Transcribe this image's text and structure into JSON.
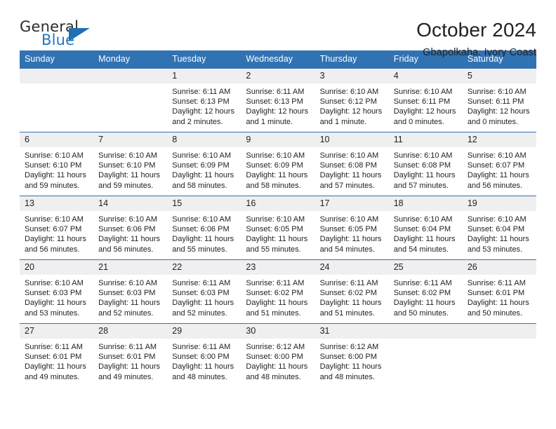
{
  "brand": {
    "name_top": "General",
    "name_bottom": "Blue",
    "color_blue": "#1f77c4",
    "color_dark": "#2b2b2b",
    "triangle_icon": "triangle-icon"
  },
  "header": {
    "title": "October 2024",
    "subtitle": "Gbapolkaha, Ivory Coast"
  },
  "theme": {
    "header_bg": "#3172b3",
    "header_text": "#ffffff",
    "daynum_bg": "#efefef",
    "cell_bg": "#ffffff",
    "text": "#222222"
  },
  "weekdays": [
    "Sunday",
    "Monday",
    "Tuesday",
    "Wednesday",
    "Thursday",
    "Friday",
    "Saturday"
  ],
  "weeks": [
    [
      {
        "day": "",
        "sunrise": "",
        "sunset": "",
        "daylight_1": "",
        "daylight_2": ""
      },
      {
        "day": "",
        "sunrise": "",
        "sunset": "",
        "daylight_1": "",
        "daylight_2": ""
      },
      {
        "day": "1",
        "sunrise": "Sunrise: 6:11 AM",
        "sunset": "Sunset: 6:13 PM",
        "daylight_1": "Daylight: 12 hours",
        "daylight_2": "and 2 minutes."
      },
      {
        "day": "2",
        "sunrise": "Sunrise: 6:11 AM",
        "sunset": "Sunset: 6:13 PM",
        "daylight_1": "Daylight: 12 hours",
        "daylight_2": "and 1 minute."
      },
      {
        "day": "3",
        "sunrise": "Sunrise: 6:10 AM",
        "sunset": "Sunset: 6:12 PM",
        "daylight_1": "Daylight: 12 hours",
        "daylight_2": "and 1 minute."
      },
      {
        "day": "4",
        "sunrise": "Sunrise: 6:10 AM",
        "sunset": "Sunset: 6:11 PM",
        "daylight_1": "Daylight: 12 hours",
        "daylight_2": "and 0 minutes."
      },
      {
        "day": "5",
        "sunrise": "Sunrise: 6:10 AM",
        "sunset": "Sunset: 6:11 PM",
        "daylight_1": "Daylight: 12 hours",
        "daylight_2": "and 0 minutes."
      }
    ],
    [
      {
        "day": "6",
        "sunrise": "Sunrise: 6:10 AM",
        "sunset": "Sunset: 6:10 PM",
        "daylight_1": "Daylight: 11 hours",
        "daylight_2": "and 59 minutes."
      },
      {
        "day": "7",
        "sunrise": "Sunrise: 6:10 AM",
        "sunset": "Sunset: 6:10 PM",
        "daylight_1": "Daylight: 11 hours",
        "daylight_2": "and 59 minutes."
      },
      {
        "day": "8",
        "sunrise": "Sunrise: 6:10 AM",
        "sunset": "Sunset: 6:09 PM",
        "daylight_1": "Daylight: 11 hours",
        "daylight_2": "and 58 minutes."
      },
      {
        "day": "9",
        "sunrise": "Sunrise: 6:10 AM",
        "sunset": "Sunset: 6:09 PM",
        "daylight_1": "Daylight: 11 hours",
        "daylight_2": "and 58 minutes."
      },
      {
        "day": "10",
        "sunrise": "Sunrise: 6:10 AM",
        "sunset": "Sunset: 6:08 PM",
        "daylight_1": "Daylight: 11 hours",
        "daylight_2": "and 57 minutes."
      },
      {
        "day": "11",
        "sunrise": "Sunrise: 6:10 AM",
        "sunset": "Sunset: 6:08 PM",
        "daylight_1": "Daylight: 11 hours",
        "daylight_2": "and 57 minutes."
      },
      {
        "day": "12",
        "sunrise": "Sunrise: 6:10 AM",
        "sunset": "Sunset: 6:07 PM",
        "daylight_1": "Daylight: 11 hours",
        "daylight_2": "and 56 minutes."
      }
    ],
    [
      {
        "day": "13",
        "sunrise": "Sunrise: 6:10 AM",
        "sunset": "Sunset: 6:07 PM",
        "daylight_1": "Daylight: 11 hours",
        "daylight_2": "and 56 minutes."
      },
      {
        "day": "14",
        "sunrise": "Sunrise: 6:10 AM",
        "sunset": "Sunset: 6:06 PM",
        "daylight_1": "Daylight: 11 hours",
        "daylight_2": "and 56 minutes."
      },
      {
        "day": "15",
        "sunrise": "Sunrise: 6:10 AM",
        "sunset": "Sunset: 6:06 PM",
        "daylight_1": "Daylight: 11 hours",
        "daylight_2": "and 55 minutes."
      },
      {
        "day": "16",
        "sunrise": "Sunrise: 6:10 AM",
        "sunset": "Sunset: 6:05 PM",
        "daylight_1": "Daylight: 11 hours",
        "daylight_2": "and 55 minutes."
      },
      {
        "day": "17",
        "sunrise": "Sunrise: 6:10 AM",
        "sunset": "Sunset: 6:05 PM",
        "daylight_1": "Daylight: 11 hours",
        "daylight_2": "and 54 minutes."
      },
      {
        "day": "18",
        "sunrise": "Sunrise: 6:10 AM",
        "sunset": "Sunset: 6:04 PM",
        "daylight_1": "Daylight: 11 hours",
        "daylight_2": "and 54 minutes."
      },
      {
        "day": "19",
        "sunrise": "Sunrise: 6:10 AM",
        "sunset": "Sunset: 6:04 PM",
        "daylight_1": "Daylight: 11 hours",
        "daylight_2": "and 53 minutes."
      }
    ],
    [
      {
        "day": "20",
        "sunrise": "Sunrise: 6:10 AM",
        "sunset": "Sunset: 6:03 PM",
        "daylight_1": "Daylight: 11 hours",
        "daylight_2": "and 53 minutes."
      },
      {
        "day": "21",
        "sunrise": "Sunrise: 6:10 AM",
        "sunset": "Sunset: 6:03 PM",
        "daylight_1": "Daylight: 11 hours",
        "daylight_2": "and 52 minutes."
      },
      {
        "day": "22",
        "sunrise": "Sunrise: 6:11 AM",
        "sunset": "Sunset: 6:03 PM",
        "daylight_1": "Daylight: 11 hours",
        "daylight_2": "and 52 minutes."
      },
      {
        "day": "23",
        "sunrise": "Sunrise: 6:11 AM",
        "sunset": "Sunset: 6:02 PM",
        "daylight_1": "Daylight: 11 hours",
        "daylight_2": "and 51 minutes."
      },
      {
        "day": "24",
        "sunrise": "Sunrise: 6:11 AM",
        "sunset": "Sunset: 6:02 PM",
        "daylight_1": "Daylight: 11 hours",
        "daylight_2": "and 51 minutes."
      },
      {
        "day": "25",
        "sunrise": "Sunrise: 6:11 AM",
        "sunset": "Sunset: 6:02 PM",
        "daylight_1": "Daylight: 11 hours",
        "daylight_2": "and 50 minutes."
      },
      {
        "day": "26",
        "sunrise": "Sunrise: 6:11 AM",
        "sunset": "Sunset: 6:01 PM",
        "daylight_1": "Daylight: 11 hours",
        "daylight_2": "and 50 minutes."
      }
    ],
    [
      {
        "day": "27",
        "sunrise": "Sunrise: 6:11 AM",
        "sunset": "Sunset: 6:01 PM",
        "daylight_1": "Daylight: 11 hours",
        "daylight_2": "and 49 minutes."
      },
      {
        "day": "28",
        "sunrise": "Sunrise: 6:11 AM",
        "sunset": "Sunset: 6:01 PM",
        "daylight_1": "Daylight: 11 hours",
        "daylight_2": "and 49 minutes."
      },
      {
        "day": "29",
        "sunrise": "Sunrise: 6:11 AM",
        "sunset": "Sunset: 6:00 PM",
        "daylight_1": "Daylight: 11 hours",
        "daylight_2": "and 48 minutes."
      },
      {
        "day": "30",
        "sunrise": "Sunrise: 6:12 AM",
        "sunset": "Sunset: 6:00 PM",
        "daylight_1": "Daylight: 11 hours",
        "daylight_2": "and 48 minutes."
      },
      {
        "day": "31",
        "sunrise": "Sunrise: 6:12 AM",
        "sunset": "Sunset: 6:00 PM",
        "daylight_1": "Daylight: 11 hours",
        "daylight_2": "and 48 minutes."
      },
      {
        "day": "",
        "sunrise": "",
        "sunset": "",
        "daylight_1": "",
        "daylight_2": ""
      },
      {
        "day": "",
        "sunrise": "",
        "sunset": "",
        "daylight_1": "",
        "daylight_2": ""
      }
    ]
  ]
}
